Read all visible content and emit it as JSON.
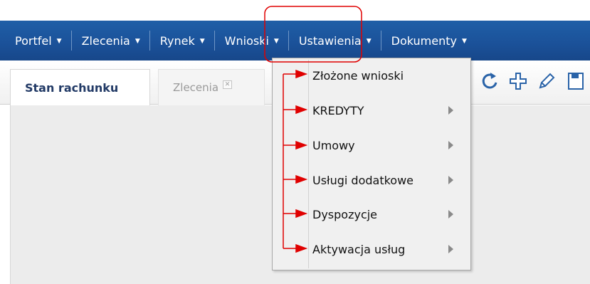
{
  "menubar": {
    "items": [
      {
        "label": "Portfel"
      },
      {
        "label": "Zlecenia"
      },
      {
        "label": "Rynek"
      },
      {
        "label": "Wnioski"
      },
      {
        "label": "Ustawienia"
      },
      {
        "label": "Dokumenty"
      }
    ],
    "caret": "▼"
  },
  "tabs": {
    "active_label": "Stan rachunku",
    "inactive_label": "Zlecenia",
    "close_glyph": "✕"
  },
  "toolbar": {
    "icons": [
      "refresh-icon",
      "add-icon",
      "edit-icon",
      "save-icon"
    ]
  },
  "dropdown": {
    "items": [
      {
        "label": "Złożone wnioski",
        "has_submenu": false
      },
      {
        "label": "KREDYTY",
        "has_submenu": true
      },
      {
        "label": "Umowy",
        "has_submenu": true
      },
      {
        "label": "Usługi dodatkowe",
        "has_submenu": true
      },
      {
        "label": "Dyspozycje",
        "has_submenu": true
      },
      {
        "label": "Aktywacja usług",
        "has_submenu": true
      }
    ]
  },
  "colors": {
    "menubar": "#1b529a",
    "annotation": "#e00000",
    "tab_active_text": "#223a66"
  }
}
